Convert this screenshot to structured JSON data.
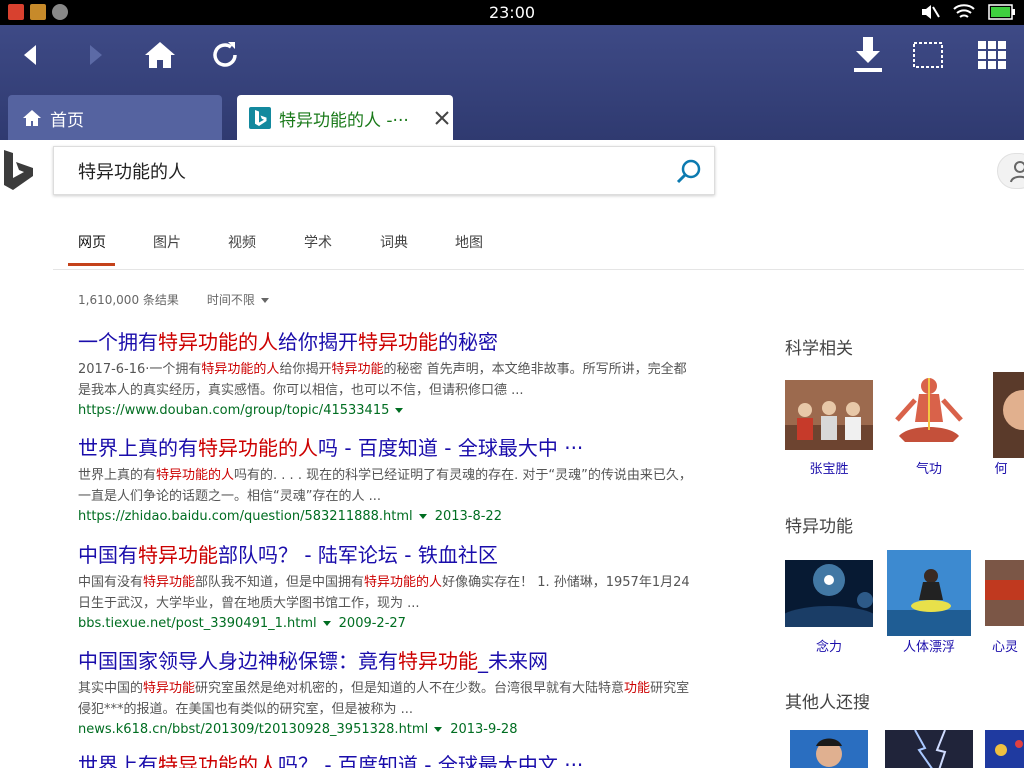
{
  "status_bar": {
    "time": "23:00"
  },
  "tabs": [
    {
      "label": "首页",
      "icon": "home-icon"
    },
    {
      "label": "特异功能的人 -···",
      "icon": "bing-icon"
    }
  ],
  "search": {
    "query": "特异功能的人"
  },
  "scopes": [
    "网页",
    "图片",
    "视频",
    "学术",
    "词典",
    "地图"
  ],
  "results_meta": {
    "count": "1,610,000 条结果",
    "time_filter": "时间不限"
  },
  "results": [
    {
      "title": [
        [
          "一个拥有",
          0
        ],
        [
          "特异功能的人",
          1
        ],
        [
          "给你揭开",
          0
        ],
        [
          "特异功能",
          1
        ],
        [
          "的秘密",
          0
        ]
      ],
      "snippet": [
        [
          "2017-6-16·一个拥有",
          0
        ],
        [
          "特异功能的人",
          1
        ],
        [
          "给你揭开",
          0
        ],
        [
          "特异功能",
          1
        ],
        [
          "的秘密  首先声明，本文绝非故事。所写所讲，完全都是我本人的真实经历，真实感悟。你可以相信，也可以不信，但请积修口德 ...",
          0
        ]
      ],
      "url": "https://www.douban.com/group/topic/41533415",
      "date": ""
    },
    {
      "title": [
        [
          "世界上真的有",
          0
        ],
        [
          "特异功能的人",
          1
        ],
        [
          "吗 - 百度知道 - 全球最大中 ···",
          0
        ]
      ],
      "snippet": [
        [
          "世界上真的有",
          0
        ],
        [
          "特异功能的人",
          1
        ],
        [
          "吗有的. . . . 现在的科学已经证明了有灵魂的存在. 对于“灵魂”的传说由来已久，一直是人们争论的话题之一。相信“灵魂”存在的人 ...",
          0
        ]
      ],
      "url": "https://zhidao.baidu.com/question/583211888.html",
      "date": "2013-8-22"
    },
    {
      "title": [
        [
          "中国有",
          0
        ],
        [
          "特异功能",
          1
        ],
        [
          "部队吗？ - 陆军论坛 - 铁血社区",
          0
        ]
      ],
      "snippet": [
        [
          "中国有没有",
          0
        ],
        [
          "特异功能",
          1
        ],
        [
          "部队我不知道，但是中国拥有",
          0
        ],
        [
          "特异功能的人",
          1
        ],
        [
          "好像确实存在！ 1. 孙储琳，1957年1月24日生于武汉，大学毕业，曾在地质大学图书馆工作，现为 ...",
          0
        ]
      ],
      "url": "bbs.tiexue.net/post_3390491_1.html",
      "date": "2009-2-27"
    },
    {
      "title": [
        [
          "中国国家领导人身边神秘保镖：竟有",
          0
        ],
        [
          "特异功能",
          1
        ],
        [
          "_未来网",
          0
        ]
      ],
      "snippet": [
        [
          "其实中国的",
          0
        ],
        [
          "特异功能",
          1
        ],
        [
          "研究室虽然是绝对机密的，但是知道的人不在少数。台湾很早就有大陆特意",
          0
        ],
        [
          "功能",
          1
        ],
        [
          "研究室侵犯***的报道。在美国也有类似的研究室，但是被称为 ...",
          0
        ]
      ],
      "url": "news.k618.cn/bbst/201309/t20130928_3951328.html",
      "date": "2013-9-28"
    },
    {
      "title": [
        [
          "世界上有",
          0
        ],
        [
          "特异功能的人",
          1
        ],
        [
          "吗？ - 百度知道 - 全球最大中文 ···",
          0
        ]
      ],
      "snippet": [],
      "url": "",
      "date": ""
    }
  ],
  "sidebar": {
    "sections": [
      {
        "title": "科学相关",
        "items": [
          "张宝胜",
          "气功",
          "何"
        ]
      },
      {
        "title": "特异功能",
        "items": [
          "念力",
          "人体漂浮",
          "心灵"
        ]
      },
      {
        "title": "其他人还搜",
        "items": [
          "",
          "",
          ""
        ]
      }
    ]
  }
}
